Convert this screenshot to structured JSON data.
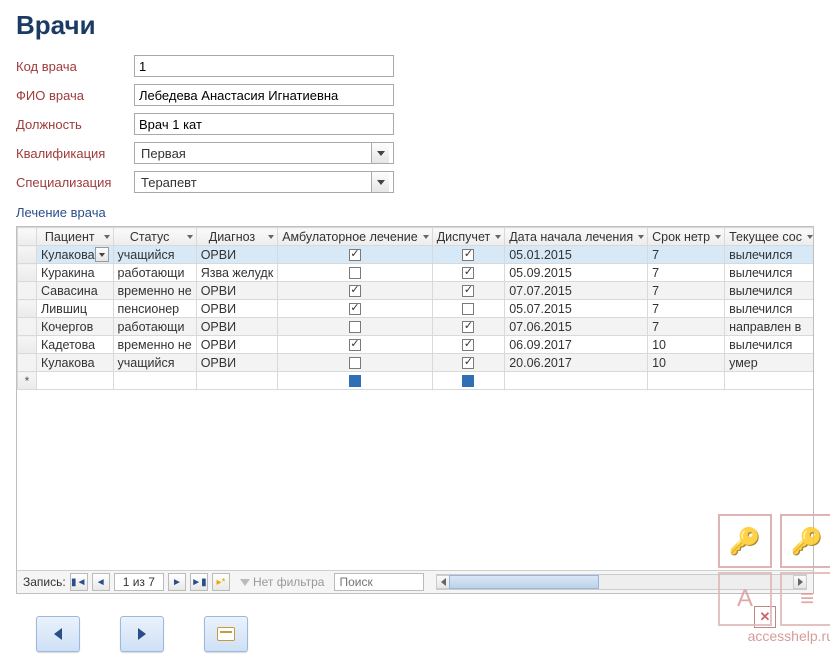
{
  "title": "Врачи",
  "form": {
    "labels": {
      "code": "Код врача",
      "name": "ФИО врача",
      "position": "Должность",
      "qual": "Квалификация",
      "spec": "Специализация"
    },
    "values": {
      "code": "1",
      "name": "Лебедева Анастасия Игнатиевна",
      "position": "Врач 1 кат",
      "qual": "Первая",
      "spec": "Терапевт"
    }
  },
  "subform_title": "Лечение врача",
  "columns": [
    "Пациент",
    "Статус",
    "Диагноз",
    "Амбулаторное лечение",
    "Диспучет",
    "Дата начала лечения",
    "Срок нетр",
    "Текущее сос"
  ],
  "rows": [
    {
      "patient": "Кулакова",
      "status": "учащийся",
      "diag": "ОРВИ",
      "amb": true,
      "disp": true,
      "date": "05.01.2015",
      "days": "7",
      "state": "вылечился",
      "selected": true,
      "combo": true
    },
    {
      "patient": "Куракина",
      "status": "работающи",
      "diag": "Язва желудк",
      "amb": false,
      "disp": true,
      "date": "05.09.2015",
      "days": "7",
      "state": "вылечился"
    },
    {
      "patient": "Савасина",
      "status": "временно не",
      "diag": "ОРВИ",
      "amb": true,
      "disp": true,
      "date": "07.07.2015",
      "days": "7",
      "state": "вылечился"
    },
    {
      "patient": "Лившиц",
      "status": "пенсионер",
      "diag": "ОРВИ",
      "amb": true,
      "disp": false,
      "date": "05.07.2015",
      "days": "7",
      "state": "вылечился"
    },
    {
      "patient": "Кочергов",
      "status": "работающи",
      "diag": "ОРВИ",
      "amb": false,
      "disp": true,
      "date": "07.06.2015",
      "days": "7",
      "state": "направлен в"
    },
    {
      "patient": "Кадетова",
      "status": "временно не",
      "diag": "ОРВИ",
      "amb": true,
      "disp": true,
      "date": "06.09.2017",
      "days": "10",
      "state": "вылечился"
    },
    {
      "patient": "Кулакова",
      "status": "учащийся",
      "diag": "ОРВИ",
      "amb": false,
      "disp": true,
      "date": "20.06.2017",
      "days": "10",
      "state": "умер"
    }
  ],
  "nav": {
    "label": "Запись:",
    "counter": "1 из 7",
    "nofilter": "Нет фильтра",
    "search_placeholder": "Поиск"
  },
  "watermark": "accesshelp.ru"
}
